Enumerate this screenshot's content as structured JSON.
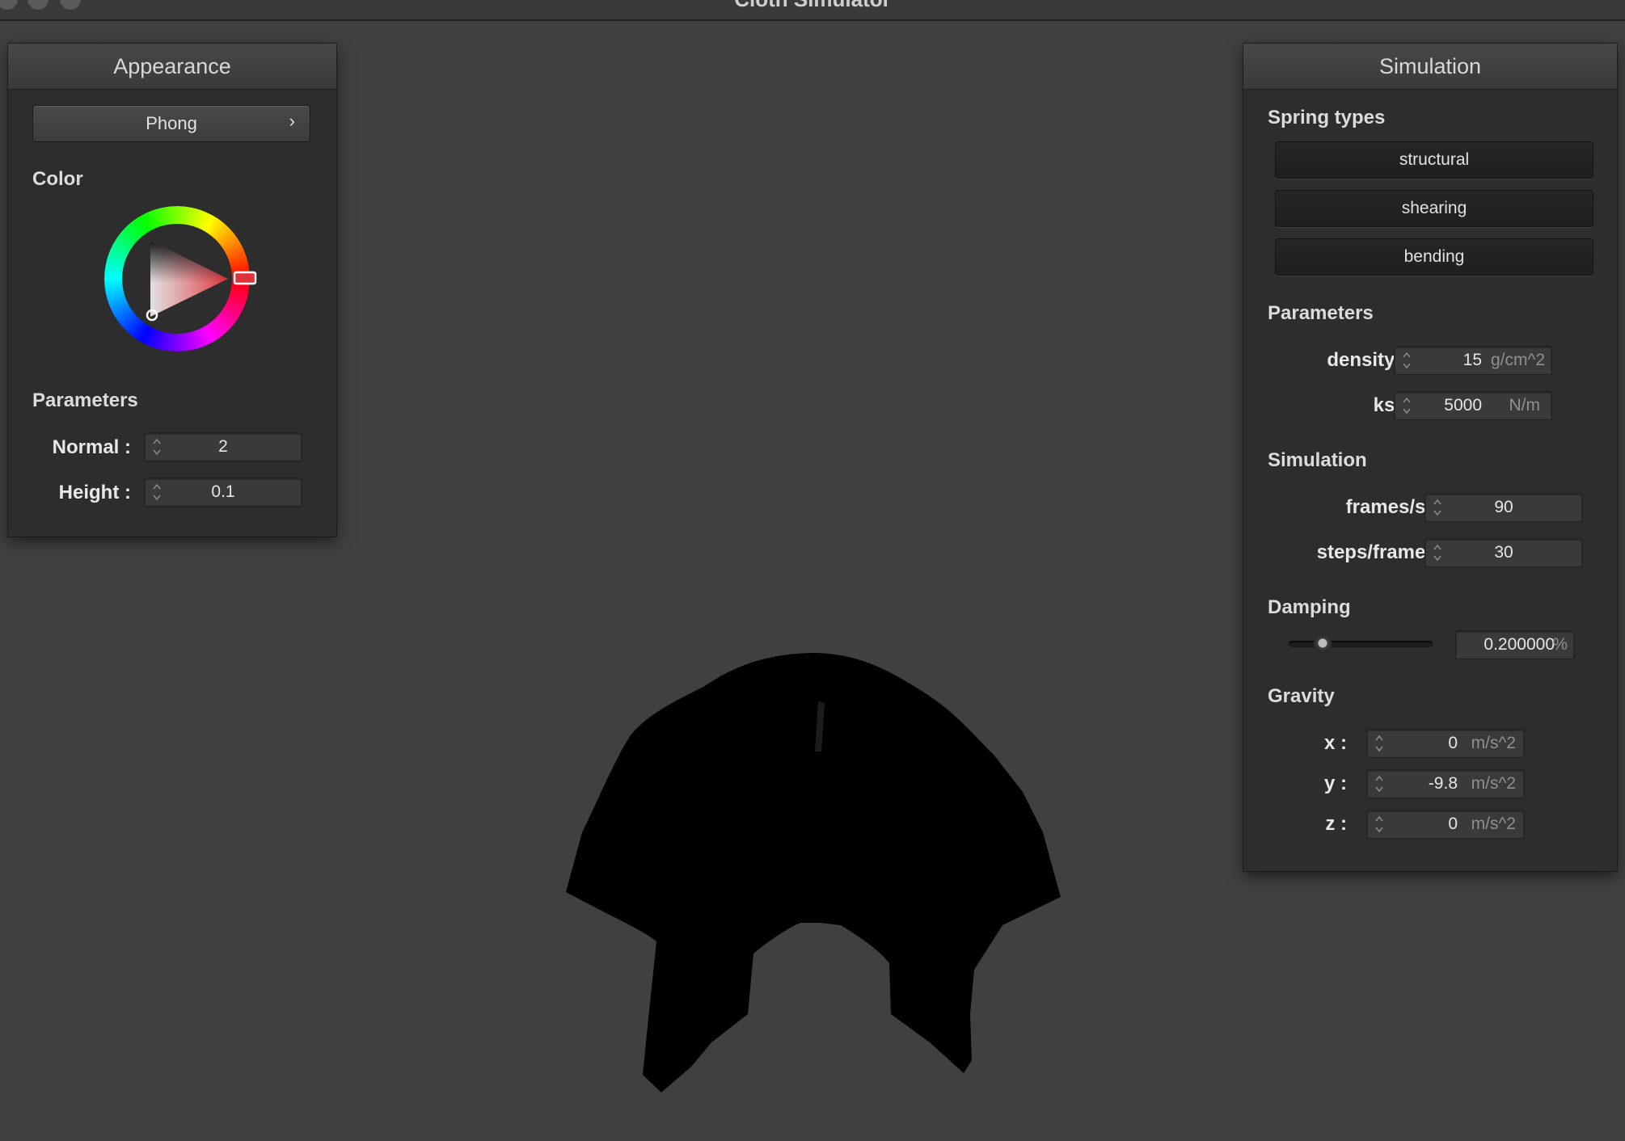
{
  "window": {
    "title": "Cloth Simulator"
  },
  "appearance": {
    "title": "Appearance",
    "shader": {
      "label": "Phong",
      "chevron": "›"
    },
    "color_label": "Color",
    "color": "#e0323a",
    "params_label": "Parameters",
    "normal": {
      "label": "Normal :",
      "value": "2"
    },
    "height": {
      "label": "Height :",
      "value": "0.1"
    }
  },
  "simulation": {
    "title": "Simulation",
    "spring_types_label": "Spring types",
    "springs": [
      "structural",
      "shearing",
      "bending"
    ],
    "params_label": "Parameters",
    "density": {
      "label": "density :",
      "value": "15",
      "unit": "g/cm^2"
    },
    "ks": {
      "label": "ks :",
      "value": "5000",
      "unit": "N/m"
    },
    "sim_label": "Simulation",
    "fps": {
      "label": "frames/s :",
      "value": "90"
    },
    "steps": {
      "label": "steps/frame :",
      "value": "30"
    },
    "damping_label": "Damping",
    "damping": {
      "value": "0.200000",
      "unit": "%",
      "fraction": 0.2
    },
    "gravity_label": "Gravity",
    "gx": {
      "label": "x :",
      "value": "0",
      "unit": "m/s^2"
    },
    "gy": {
      "label": "y :",
      "value": "-9.8",
      "unit": "m/s^2"
    },
    "gz": {
      "label": "z :",
      "value": "0",
      "unit": "m/s^2"
    }
  },
  "icons": [
    "chevron-right-icon",
    "spinner-arrows-icon",
    "color-wheel",
    "cloth-mesh"
  ]
}
